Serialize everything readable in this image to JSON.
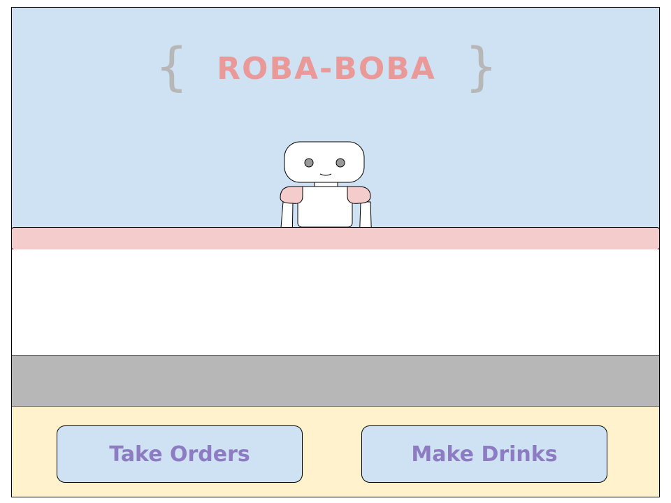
{
  "logo": {
    "text": "ROBA-BOBA",
    "open_brace": "{",
    "close_brace": "}"
  },
  "buttons": {
    "take_orders": "Take Orders",
    "make_drinks": "Make Drinks"
  },
  "colors": {
    "sky": "#cfe2f3",
    "counter_top": "#f4cccc",
    "floor": "#b7b7b7",
    "button_bar": "#fff2cc",
    "button_bg": "#cfe2f3",
    "button_text": "#8e7cc3",
    "logo_text": "#ea9999",
    "brace": "#b7b7b7"
  },
  "icons": {
    "robot": "robot-barista-icon"
  }
}
